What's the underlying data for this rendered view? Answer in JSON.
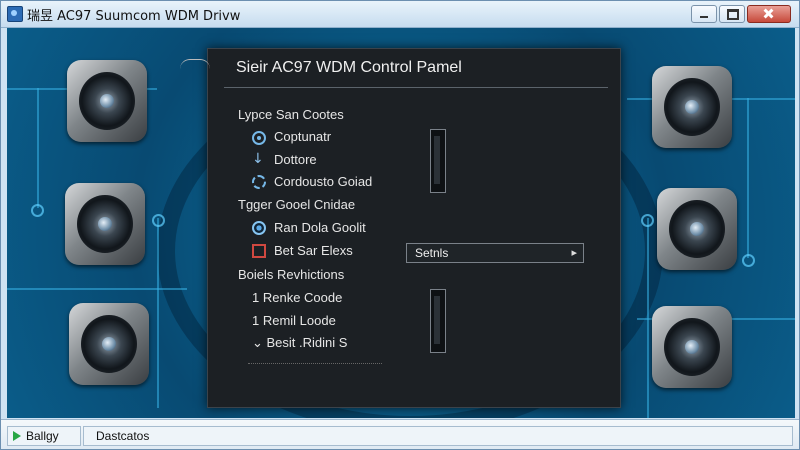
{
  "window": {
    "title": "瑞昱 AC97 Suumcom WDM Drivw",
    "controls": [
      "minimize",
      "maximize",
      "close"
    ]
  },
  "panel": {
    "title": "Sieir AC97 WDM Control Pamel",
    "sections": [
      {
        "header": "Lypce San Cootes",
        "items": [
          {
            "icon": "disc-icon",
            "label": "Coptunatr"
          },
          {
            "icon": "down-arrow-icon",
            "label": "Dottore"
          },
          {
            "icon": "cog-icon",
            "label": "Cordousto Goiad"
          }
        ]
      },
      {
        "header": "Tgger Gooel Cnidae",
        "items": [
          {
            "icon": "radio-icon",
            "label": "Ran Dola Goolit"
          },
          {
            "icon": "red-box-icon",
            "label": "Bet Sar Elexs"
          }
        ]
      },
      {
        "header": "Boiels Revhictions",
        "items": [
          {
            "icon": "",
            "label": "1 Renke Coode"
          },
          {
            "icon": "",
            "label": "1 Remil Loode"
          },
          {
            "icon": "",
            "label": "⌄ Besit .Ridini S"
          }
        ]
      }
    ],
    "dropdown": {
      "selected": "Setnls"
    }
  },
  "statusbar": {
    "left": "Ballgy",
    "right": "Dastcatos"
  },
  "colors": {
    "desktop": "#0a5b86",
    "panel": "#1c2024",
    "accent": "#37b2e6"
  }
}
